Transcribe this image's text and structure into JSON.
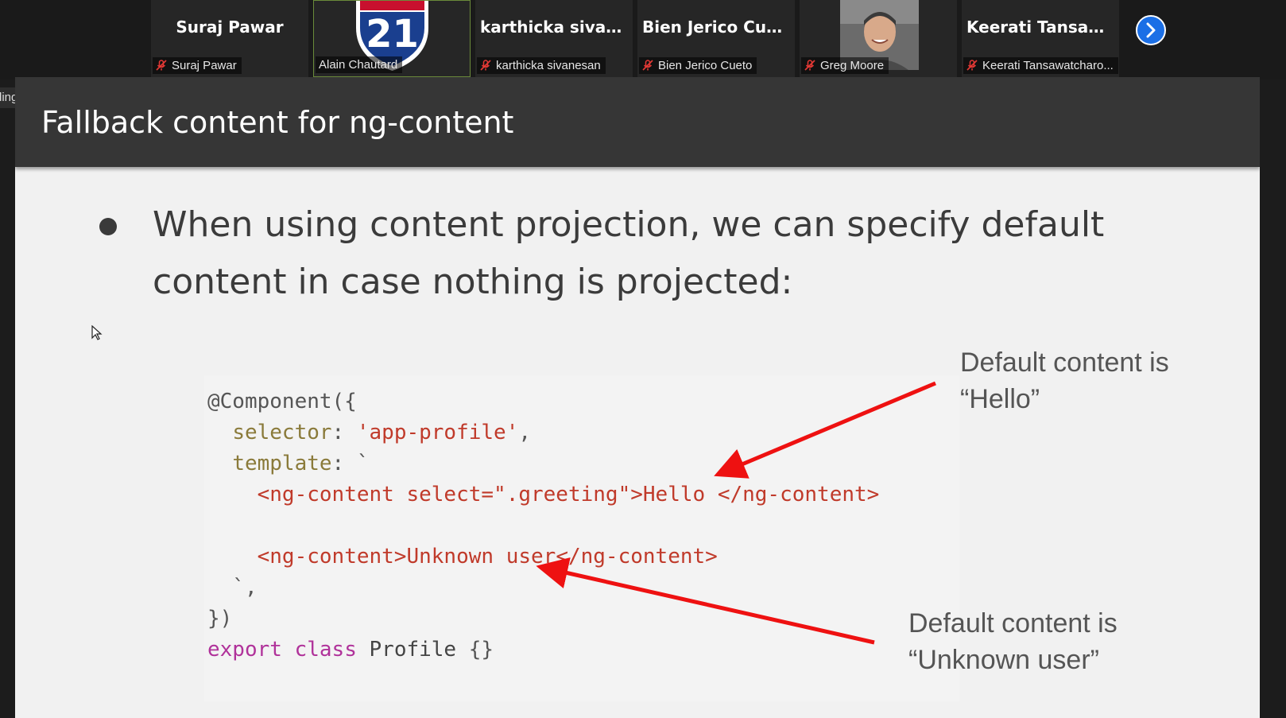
{
  "participants": [
    {
      "display_name": "Suraj Pawar",
      "label": "Suraj Pawar",
      "muted": true,
      "media": "name"
    },
    {
      "display_name": "",
      "label": "Alain Chautard",
      "muted": false,
      "media": "shield",
      "shield_number": "21",
      "active": true
    },
    {
      "display_name": "karthicka  sivane...",
      "label": "karthicka sivanesan",
      "muted": true,
      "media": "name"
    },
    {
      "display_name": "Bien Jerico Cueto",
      "label": "Bien Jerico Cueto",
      "muted": true,
      "media": "name"
    },
    {
      "display_name": "",
      "label": "Greg Moore",
      "muted": true,
      "media": "photo"
    },
    {
      "display_name": "Keerati  Tansawa...",
      "label": "Keerati Tansawatcharo...",
      "muted": true,
      "media": "name"
    }
  ],
  "recording_label": "ding",
  "slide": {
    "title": "Fallback content for ng-content",
    "bullet": "When using content projection, we can specify default content in case nothing is projected:",
    "code": {
      "line1": "@Component({",
      "selector_key": "selector",
      "selector_value": "'app-profile'",
      "template_key": "template",
      "ng1_open": "<ng-content select=\".greeting\">",
      "ng1_text": "Hello ",
      "ng1_close": "</ng-content>",
      "ng2_open": "<ng-content>",
      "ng2_text": "Unknown user",
      "ng2_close": "</ng-content>",
      "end_template": "`,",
      "end_decorator": "})",
      "kw_export": "export",
      "kw_class": "class",
      "class_name": "Profile",
      "class_body": "{}"
    },
    "annotations": [
      {
        "line1": "Default content is",
        "line2": "“Hello”"
      },
      {
        "line1": "Default content is",
        "line2": "“Unknown user”"
      }
    ]
  },
  "colors": {
    "arrow": "#ee1111",
    "keyword": "#b0329a",
    "tag": "#c03a2a",
    "property": "#8a7a3a",
    "slide_header": "#363636",
    "next_button": "#1b6fe6"
  },
  "icons": {
    "muted": "mic-muted-icon",
    "next": "chevron-right-icon",
    "cursor": "mouse-cursor-icon"
  }
}
